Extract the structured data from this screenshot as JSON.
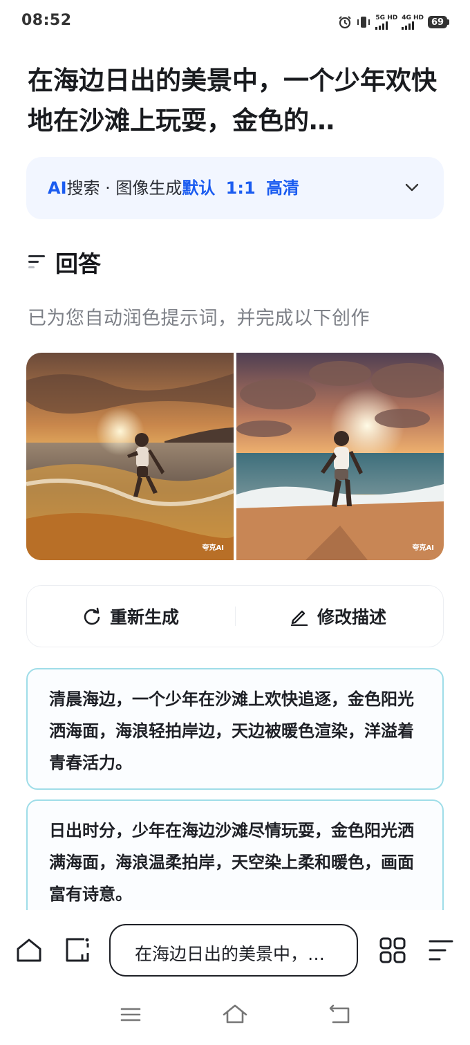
{
  "status_bar": {
    "time": "08:52",
    "sim1_label": "5G HD",
    "sim2_label": "4G HD",
    "battery": "69"
  },
  "title": "在海边日出的美景中，一个少年欢快地在沙滩上玩耍，金色的…",
  "mode_bar": {
    "ai": "AI",
    "search": "搜索",
    "separator": " · ",
    "mode": "图像生成",
    "style": "默认",
    "ratio": "1:1",
    "quality": "高清"
  },
  "answer": {
    "heading": "回答",
    "subtitle": "已为您自动润色提示词，并完成以下创作"
  },
  "images": [
    {
      "watermark": "夸克AI"
    },
    {
      "watermark": "夸克AI"
    }
  ],
  "actions": {
    "regenerate": "重新生成",
    "edit": "修改描述"
  },
  "suggestions": [
    "清晨海边，一个少年在沙滩上欢快追逐，金色阳光洒海面，海浪轻拍岸边，天边被暖色渲染，洋溢着青春活力。",
    "日出时分，少年在海边沙滩尽情玩耍，金色阳光洒满海面，海浪温柔拍岸，天空染上柔和暖色，画面富有诗意。"
  ],
  "bottom_bar": {
    "query": "在海边日出的美景中，…"
  }
}
